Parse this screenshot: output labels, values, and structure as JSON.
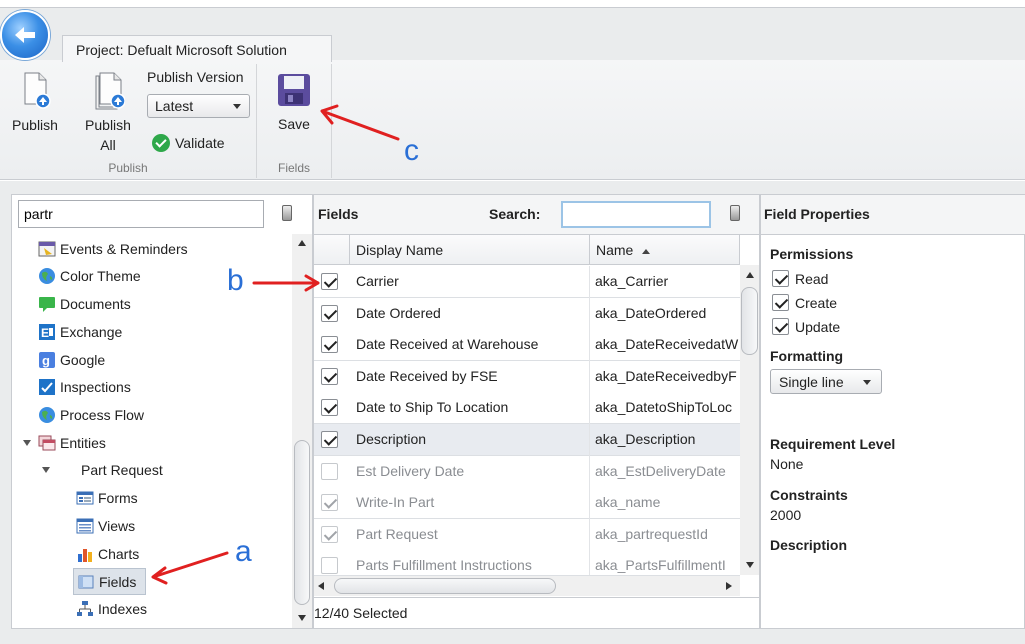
{
  "ribbon": {
    "project_tab": "Project: Defualt Microsoft Solution",
    "publish_label": "Publish",
    "publish_all_label_1": "Publish",
    "publish_all_label_2": "All",
    "publish_version_label": "Publish Version",
    "version_selected": "Latest",
    "validate_label": "Validate",
    "publish_group_label": "Publish",
    "save_label": "Save",
    "fields_group_label": "Fields"
  },
  "left": {
    "filter_value": "partr",
    "tree": [
      {
        "label": "Events & Reminders",
        "icon": "events-icon"
      },
      {
        "label": "Color Theme",
        "icon": "globe-icon"
      },
      {
        "label": "Documents",
        "icon": "documents-icon"
      },
      {
        "label": "Exchange",
        "icon": "exchange-icon"
      },
      {
        "label": "Google",
        "icon": "google-icon"
      },
      {
        "label": "Inspections",
        "icon": "inspections-icon"
      },
      {
        "label": "Process Flow",
        "icon": "globe-icon"
      },
      {
        "label": "Entities",
        "icon": "entities-icon"
      },
      {
        "label": "Part Request",
        "icon": ""
      },
      {
        "label": "Forms",
        "icon": "forms-icon"
      },
      {
        "label": "Views",
        "icon": "views-icon"
      },
      {
        "label": "Charts",
        "icon": "charts-icon"
      },
      {
        "label": "Fields",
        "icon": "fields-icon"
      },
      {
        "label": "Indexes",
        "icon": "indexes-icon"
      }
    ]
  },
  "center": {
    "title": "Fields",
    "search_label": "Search:",
    "search_value": "",
    "columns": {
      "display": "Display Name",
      "name": "Name"
    },
    "rows": [
      {
        "display": "Carrier",
        "name": "aka_Carrier",
        "checked": true,
        "enabled": true
      },
      {
        "display": "Date Ordered",
        "name": "aka_DateOrdered",
        "checked": true,
        "enabled": true
      },
      {
        "display": "Date Received at Warehouse",
        "name": "aka_DateReceivedatW",
        "checked": true,
        "enabled": true
      },
      {
        "display": "Date Received by FSE",
        "name": "aka_DateReceivedbyF",
        "checked": true,
        "enabled": true
      },
      {
        "display": "Date to Ship To Location",
        "name": "aka_DatetoShipToLoc",
        "checked": true,
        "enabled": true
      },
      {
        "display": "Description",
        "name": "aka_Description",
        "checked": true,
        "enabled": true
      },
      {
        "display": "Est Delivery Date",
        "name": "aka_EstDeliveryDate",
        "checked": false,
        "enabled": false
      },
      {
        "display": "Write-In Part",
        "name": "aka_name",
        "checked": true,
        "enabled": false
      },
      {
        "display": "Part Request",
        "name": "aka_partrequestId",
        "checked": true,
        "enabled": false
      },
      {
        "display": "Parts Fulfillment Instructions",
        "name": "aka_PartsFulfillmentI",
        "checked": false,
        "enabled": false
      }
    ],
    "status": "12/40 Selected"
  },
  "right": {
    "title": "Field Properties",
    "permissions_head": "Permissions",
    "perm_read": "Read",
    "perm_create": "Create",
    "perm_update": "Update",
    "formatting_head": "Formatting",
    "format_selected": "Single line",
    "requirement_head": "Requirement Level",
    "requirement_value": "None",
    "constraints_head": "Constraints",
    "constraints_value": "2000",
    "description_head": "Description"
  },
  "annotations": {
    "a": "a",
    "b": "b",
    "c": "c",
    "arrow_color": "#e02020",
    "letter_color": "#2a6fd6"
  }
}
